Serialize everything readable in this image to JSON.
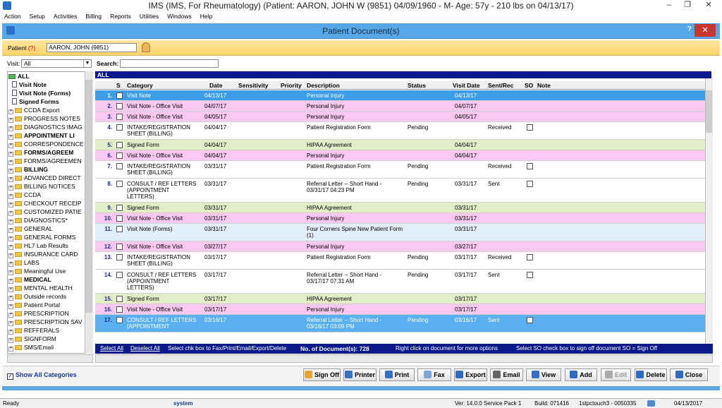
{
  "window": {
    "title": "IMS (IMS, For Rheumatology)   (Patient: AARON, JOHN W (9851) 04/09/1960 - M- Age: 57y  - 210 lbs on 04/13/17)",
    "controls": {
      "minimize": "–",
      "restore": "❐",
      "close": "✕"
    }
  },
  "menu": [
    "Action",
    "Setup",
    "Activities",
    "Billing",
    "Reports",
    "Utilities",
    "Windows",
    "Help"
  ],
  "dialog": {
    "title": "Patient Document(s)",
    "help": "?",
    "close": "✕"
  },
  "patient": {
    "label": "Patient",
    "help": "(?)",
    "value": "AARON, JOHN  (9851)"
  },
  "visit": {
    "label": "Visit:",
    "value": "All"
  },
  "search": {
    "label": "Search:"
  },
  "tree": [
    {
      "label": "ALL",
      "bold": true,
      "kind": "root"
    },
    {
      "label": "Visit Note",
      "bold": true,
      "kind": "doc"
    },
    {
      "label": "Visit Note (Forms)",
      "bold": true,
      "kind": "doc"
    },
    {
      "label": "Signed Forms",
      "bold": true,
      "kind": "doc"
    },
    {
      "label": "CCDA Export",
      "kind": "folder"
    },
    {
      "label": "PROGRESS NOTES",
      "kind": "folder"
    },
    {
      "label": "DIAGNOSTICS IMAG",
      "kind": "folder"
    },
    {
      "label": "APPOINTMENT LI",
      "bold": true,
      "kind": "folder"
    },
    {
      "label": "CORRESPONDENCE",
      "kind": "folder"
    },
    {
      "label": "FORMS/AGREEM",
      "bold": true,
      "kind": "folder"
    },
    {
      "label": "FORMS/AGREEMEN",
      "kind": "folder"
    },
    {
      "label": "BILLING",
      "bold": true,
      "kind": "folder"
    },
    {
      "label": "ADVANCED DIRECT",
      "kind": "folder"
    },
    {
      "label": "BILLING NOTICES",
      "kind": "folder"
    },
    {
      "label": "CCDA",
      "kind": "folder"
    },
    {
      "label": "CHECKOUT RECEIP",
      "kind": "folder"
    },
    {
      "label": "CUSTOMIZED PATIE",
      "kind": "folder"
    },
    {
      "label": "DIAGNOSTICS*",
      "kind": "folder"
    },
    {
      "label": "GENERAL",
      "kind": "folder"
    },
    {
      "label": "GENERAL FORMS",
      "kind": "folder"
    },
    {
      "label": "HL7 Lab Results",
      "kind": "folder"
    },
    {
      "label": "INSURANCE CARD",
      "kind": "folder"
    },
    {
      "label": "LABS",
      "kind": "folder"
    },
    {
      "label": "Meaningful Use",
      "kind": "folder"
    },
    {
      "label": "MEDICAL",
      "bold": true,
      "kind": "folder"
    },
    {
      "label": "MENTAL HEALTH",
      "kind": "folder"
    },
    {
      "label": "Outside records",
      "kind": "folder"
    },
    {
      "label": "Patient Portal",
      "kind": "folder"
    },
    {
      "label": "PRESCRIPTION",
      "kind": "folder"
    },
    {
      "label": "PRESCRIPTION SAV",
      "kind": "folder"
    },
    {
      "label": "REFFERALS",
      "kind": "folder"
    },
    {
      "label": "SIGNFORM",
      "kind": "folder"
    },
    {
      "label": "SMS/Email",
      "kind": "folder"
    }
  ],
  "grid": {
    "group_label": "ALL",
    "headers": {
      "s": "S",
      "category": "Category",
      "date": "Date",
      "sensitivity": "Sensitivity",
      "priority": "Priority",
      "description": "Description",
      "status": "Status",
      "visit_date": "Visit Date",
      "sent_rec": "Sent/Rec",
      "so": "SO",
      "note": "Note"
    },
    "rows": [
      {
        "num": "1.",
        "category": [
          "Visit Note"
        ],
        "date": "04/13/17",
        "description": [
          "Personal Injury"
        ],
        "status": "",
        "visit_date": "04/13/17",
        "sent_rec": "",
        "so": false,
        "color": "#3d9de6",
        "selected": true
      },
      {
        "num": "2.",
        "category": [
          "Visit Note - Office Visit"
        ],
        "date": "04/07/17",
        "description": [
          "Personal Injury"
        ],
        "status": "",
        "visit_date": "04/07/17",
        "sent_rec": "",
        "so": false,
        "color": "#fac8f0"
      },
      {
        "num": "3.",
        "category": [
          "Visit Note - Office Visit"
        ],
        "date": "04/05/17",
        "description": [
          "Personal Injury"
        ],
        "status": "",
        "visit_date": "04/05/17",
        "sent_rec": "",
        "so": false,
        "color": "#fac8f0"
      },
      {
        "num": "4.",
        "category": [
          "INTAKE/REGISTRATION",
          "SHEET (BILLING)"
        ],
        "date": "04/04/17",
        "description": [
          "Patient Registration Form"
        ],
        "status": "Pending",
        "visit_date": "",
        "sent_rec": "Received",
        "so": true,
        "color": "#ffffff"
      },
      {
        "num": "5.",
        "category": [
          "Signed Form"
        ],
        "date": "04/04/17",
        "description": [
          "HIPAA Agreement"
        ],
        "status": "",
        "visit_date": "04/04/17",
        "sent_rec": "",
        "so": false,
        "color": "#e3edc7"
      },
      {
        "num": "6.",
        "category": [
          "Visit Note - Office Visit"
        ],
        "date": "04/04/17",
        "description": [
          "Personal Injury"
        ],
        "status": "",
        "visit_date": "04/04/17",
        "sent_rec": "",
        "so": false,
        "color": "#fac8f0"
      },
      {
        "num": "7.",
        "category": [
          "INTAKE/REGISTRATION",
          "SHEET (BILLING)"
        ],
        "date": "03/31/17",
        "description": [
          "Patient Registration Form"
        ],
        "status": "Pending",
        "visit_date": "",
        "sent_rec": "Received",
        "so": true,
        "color": "#ffffff"
      },
      {
        "num": "8.",
        "category": [
          "CONSULT / REF LETTERS",
          "(APPOINTMENT",
          "LETTERS)"
        ],
        "date": "03/31/17",
        "description": [
          "Referral Letter -- Short Hand -",
          "03/31/17 04:23 PM"
        ],
        "status": "Pending",
        "visit_date": "03/31/17",
        "sent_rec": "Sent",
        "so": true,
        "color": "#ffffff"
      },
      {
        "num": "9.",
        "category": [
          "Signed Form"
        ],
        "date": "03/31/17",
        "description": [
          "HIPAA Agreement"
        ],
        "status": "",
        "visit_date": "03/31/17",
        "sent_rec": "",
        "so": false,
        "color": "#e3edc7"
      },
      {
        "num": "10.",
        "category": [
          "Visit Note - Office Visit"
        ],
        "date": "03/31/17",
        "description": [
          "Personal Injury"
        ],
        "status": "",
        "visit_date": "03/31/17",
        "sent_rec": "",
        "so": false,
        "color": "#fac8f0"
      },
      {
        "num": "11.",
        "category": [
          "Visit Note (Forms)"
        ],
        "date": "03/31/17",
        "description": [
          "Four Corners Spine New Patient Form",
          "(1)"
        ],
        "status": "",
        "visit_date": "03/31/17",
        "sent_rec": "",
        "so": false,
        "color": "#e2eefa"
      },
      {
        "num": "12.",
        "category": [
          "Visit Note - Office Visit"
        ],
        "date": "03/27/17",
        "description": [
          "Personal Injury"
        ],
        "status": "",
        "visit_date": "03/27/17",
        "sent_rec": "",
        "so": false,
        "color": "#fac8f0"
      },
      {
        "num": "13.",
        "category": [
          "INTAKE/REGISTRATION",
          "SHEET (BILLING)"
        ],
        "date": "03/17/17",
        "description": [
          "Patient Registration Form"
        ],
        "status": "Pending",
        "visit_date": "03/17/17",
        "sent_rec": "Received",
        "so": true,
        "color": "#ffffff"
      },
      {
        "num": "14.",
        "category": [
          "CONSULT / REF LETTERS",
          "(APPOINTMENT",
          "LETTERS)"
        ],
        "date": "03/17/17",
        "description": [
          "Referral Letter -- Short Hand -",
          "03/17/17 07:31 AM"
        ],
        "status": "Pending",
        "visit_date": "03/17/17",
        "sent_rec": "Sent",
        "so": true,
        "color": "#ffffff"
      },
      {
        "num": "15.",
        "category": [
          "Signed Form"
        ],
        "date": "03/17/17",
        "description": [
          "HIPAA Agreement"
        ],
        "status": "",
        "visit_date": "03/17/17",
        "sent_rec": "",
        "so": false,
        "color": "#e3edc7"
      },
      {
        "num": "16.",
        "category": [
          "Visit Note - Office Visit"
        ],
        "date": "03/17/17",
        "description": [
          "Personal Injury"
        ],
        "status": "",
        "visit_date": "03/17/17",
        "sent_rec": "",
        "so": false,
        "color": "#fac8f0"
      },
      {
        "num": "17.",
        "category": [
          "CONSULT / REF LETTERS",
          "(APPOINTMENT"
        ],
        "date": "03/16/17",
        "description": [
          "Referral Letter -- Short Hand -",
          "03/16/17 03:09 PM"
        ],
        "status": "Pending",
        "visit_date": "03/16/17",
        "sent_rec": "Sent",
        "so": true,
        "color": "#5ab0ee"
      }
    ]
  },
  "footer": {
    "select_all": "Select All",
    "deselect_all": "Deselect All",
    "hint": "Select chk box to Fax/Print/Email/Export/Delete",
    "count": "No. of Document(s): 728",
    "right_click": "Right click on document for more options",
    "so_hint": "Select SO check box to sign off document   SO = Sign Off"
  },
  "show_all": "Show All Categories",
  "buttons": [
    {
      "label": "Sign Off",
      "icon": "sign-off-icon",
      "color": "#e1a83a"
    },
    {
      "label": "Printer",
      "icon": "printer-icon",
      "color": "#3570c4"
    },
    {
      "label": "Print",
      "icon": "print-icon",
      "color": "#3570c4"
    },
    {
      "label": "Fax",
      "icon": "fax-icon",
      "color": "#7aa8d6"
    },
    {
      "label": "Export",
      "icon": "export-icon",
      "color": "#2f6cc0"
    },
    {
      "label": "Email",
      "icon": "email-icon",
      "color": "#666666"
    },
    {
      "label": "View",
      "icon": "view-icon",
      "color": "#3570c4"
    },
    {
      "label": "Add",
      "icon": "add-icon",
      "color": "#2f6cc0"
    },
    {
      "label": "Edit",
      "icon": "edit-icon",
      "color": "#aaaaaa",
      "disabled": true
    },
    {
      "label": "Delete",
      "icon": "delete-icon",
      "color": "#2f6cc0"
    },
    {
      "label": "Close",
      "icon": "close-icon",
      "color": "#2f6cc0"
    }
  ],
  "status": {
    "left": "Ready",
    "user": "system",
    "version": "Ver: 14.0.0 Service Pack 1",
    "build": "Build: 071416",
    "server": "1stpctouch3 - 0050335",
    "date": "04/13/2017"
  }
}
